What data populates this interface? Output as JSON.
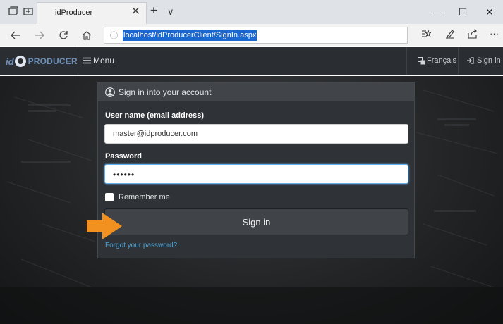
{
  "browser": {
    "tab_title": "idProducer",
    "url": "localhost/idProducerClient/SignIn.aspx",
    "new_tab_symbol": "+",
    "tab_list_symbol": "∨",
    "tab_close_symbol": "✕",
    "win_minimize": "—",
    "win_maximize": "☐",
    "win_close": "✕",
    "more_symbol": "···"
  },
  "navbar": {
    "brand_prefix": "id",
    "brand_name": "PRODUCER",
    "menu_label": "Menu",
    "language_label": "Français",
    "signin_label": "Sign in"
  },
  "signin_card": {
    "title": "Sign in into your account",
    "username_label": "User name (email address)",
    "username_value": "master@idproducer.com",
    "password_label": "Password",
    "password_value": "••••••",
    "remember_label": "Remember me",
    "signin_button": "Sign in",
    "forgot_link": "Forgot your password?"
  },
  "colors": {
    "navbar_bg": "#2a2e33",
    "card_bg": "#2f3236",
    "link": "#4aa3d9",
    "arrow": "#f39120",
    "url_highlight": "#1a67cf"
  },
  "icons": {
    "back": "arrow-left-icon",
    "forward": "arrow-right-icon",
    "refresh": "refresh-icon",
    "home": "home-icon",
    "favorites": "favorites-icon",
    "notes": "pen-icon",
    "share": "share-icon",
    "user": "user-circle-icon",
    "language": "translate-icon",
    "signin": "sign-in-icon"
  }
}
